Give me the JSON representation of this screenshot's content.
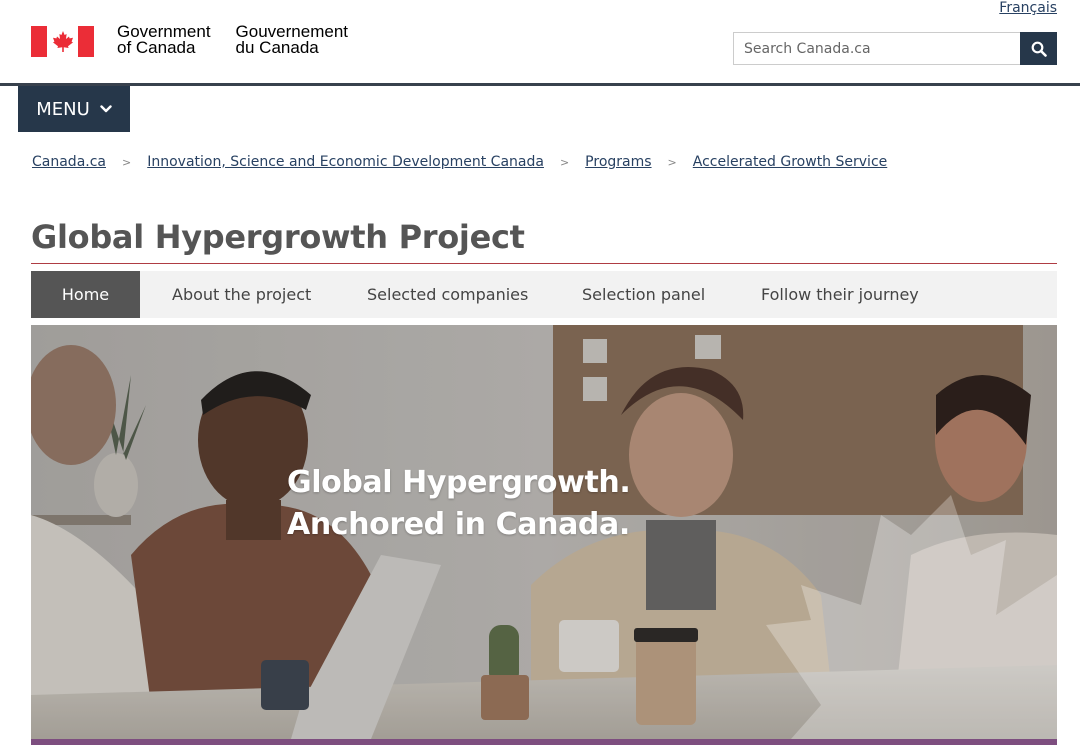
{
  "header": {
    "lang_link": "Français",
    "brand_en_line1": "Government",
    "brand_en_line2": "of Canada",
    "brand_fr_line1": "Gouvernement",
    "brand_fr_line2": "du Canada",
    "search_placeholder": "Search Canada.ca",
    "menu_label": "MENU"
  },
  "breadcrumb": [
    "Canada.ca",
    "Innovation, Science and Economic Development Canada",
    "Programs",
    "Accelerated Growth Service"
  ],
  "page_title": "Global Hypergrowth Project",
  "tabs": [
    {
      "label": "Home",
      "active": true
    },
    {
      "label": "About the project",
      "active": false
    },
    {
      "label": "Selected companies",
      "active": false
    },
    {
      "label": "Selection panel",
      "active": false
    },
    {
      "label": "Follow their journey",
      "active": false
    }
  ],
  "hero": {
    "line1": "Global Hypergrowth.",
    "line2": "Anchored in Canada."
  },
  "colors": {
    "flag_red": "#eb2d37",
    "navy": "#26374a",
    "link": "#284162",
    "title_rule": "#af3c43",
    "active_tab": "#555555",
    "hero_bar": "#7d4e7f"
  }
}
